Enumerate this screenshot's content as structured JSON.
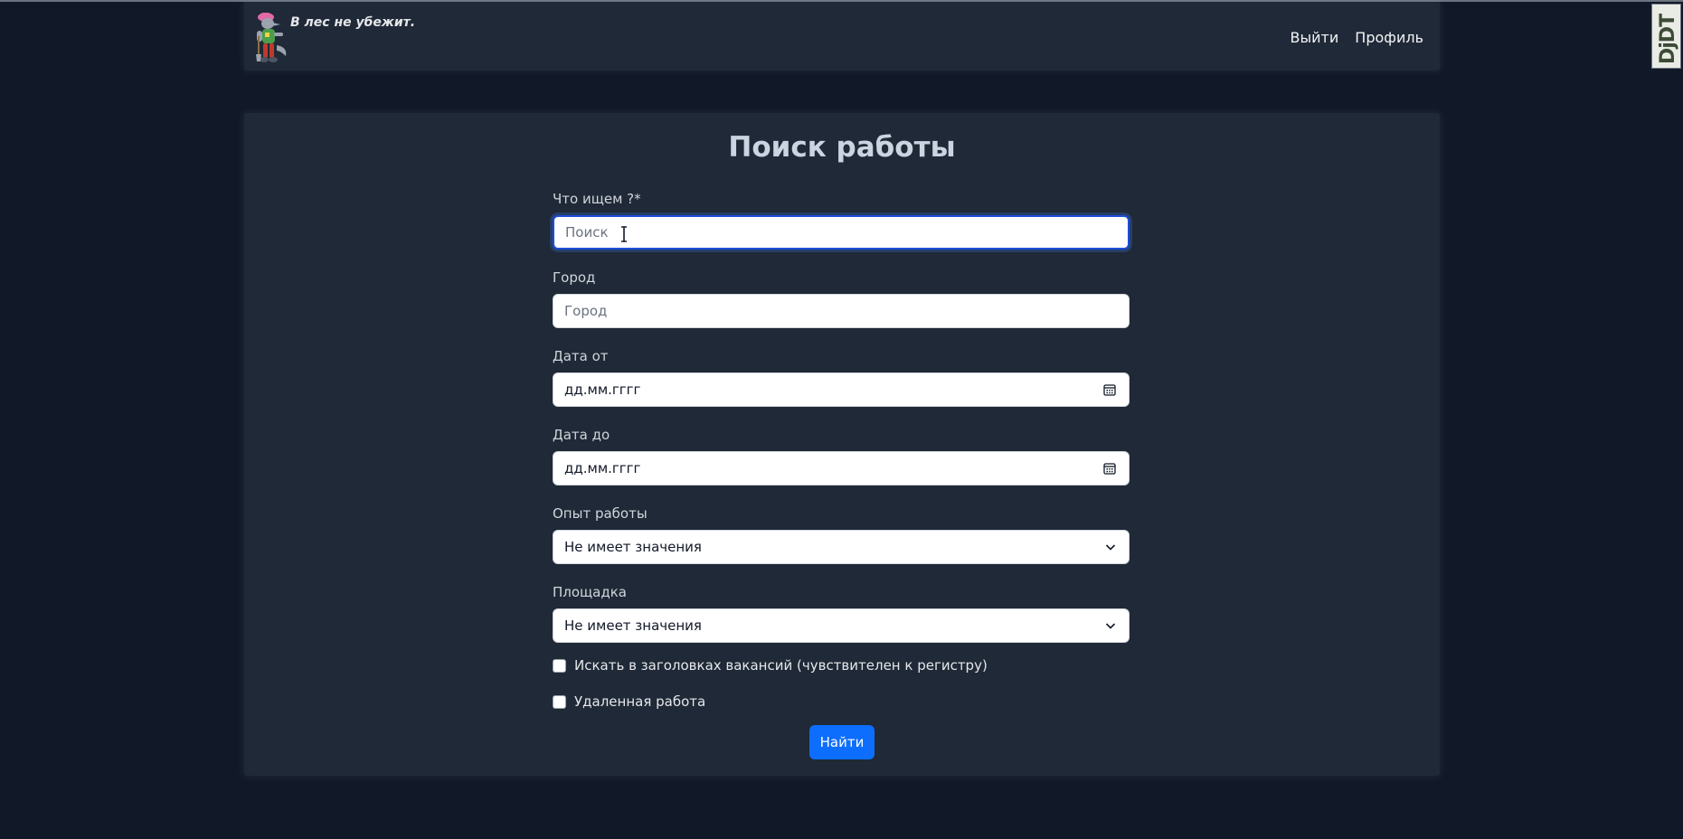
{
  "header": {
    "tagline": "В лес не убежит.",
    "nav": {
      "logout": "Выйти",
      "profile": "Профиль"
    }
  },
  "form": {
    "title": "Поиск работы",
    "query": {
      "label": "Что ищем ?*",
      "placeholder": "Поиск"
    },
    "city": {
      "label": "Город",
      "placeholder": "Город"
    },
    "date_from": {
      "label": "Дата от",
      "value": "дд.мм.гггг"
    },
    "date_to": {
      "label": "Дата до",
      "value": "дд.мм.гггг"
    },
    "experience": {
      "label": "Опыт работы",
      "selected": "Не имеет значения"
    },
    "platform": {
      "label": "Площадка",
      "selected": "Не имеет значения"
    },
    "checkboxes": {
      "titles": "Искать в заголовках вакансий (чувствителен к регистру)",
      "remote": "Удаленная работа"
    },
    "submit": "Найти"
  },
  "debug_toolbar": {
    "label": "DjDT"
  },
  "colors": {
    "background": "#111827",
    "panel": "#1f2937",
    "primary": "#0d6efd",
    "focus": "#1d4ed8"
  }
}
